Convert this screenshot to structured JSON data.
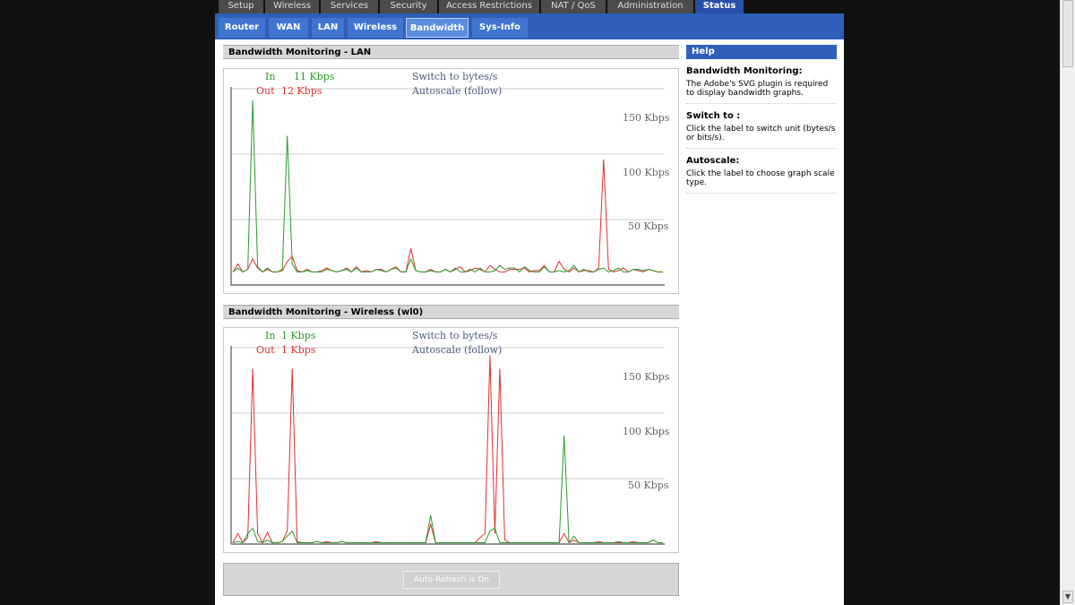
{
  "top_tabs": [
    {
      "label": "Setup",
      "active": false
    },
    {
      "label": "Wireless",
      "active": false
    },
    {
      "label": "Services",
      "active": false
    },
    {
      "label": "Security",
      "active": false
    },
    {
      "label": "Access Restrictions",
      "active": false
    },
    {
      "label": "NAT / QoS",
      "active": false
    },
    {
      "label": "Administration",
      "active": false
    },
    {
      "label": "Status",
      "active": true
    }
  ],
  "sub_tabs": [
    {
      "label": "Router",
      "active": false
    },
    {
      "label": "WAN",
      "active": false
    },
    {
      "label": "LAN",
      "active": false
    },
    {
      "label": "Wireless",
      "active": false
    },
    {
      "label": "Bandwidth",
      "active": true
    },
    {
      "label": "Sys-Info",
      "active": false
    }
  ],
  "colors": {
    "in": "#2a9a2a",
    "out": "#e03030",
    "accent": "#2f5fb8"
  },
  "lan": {
    "title": "Bandwidth Monitoring - LAN",
    "in_label": "In",
    "in_value": "11 Kbps",
    "out_label": "Out",
    "out_value": "12 Kbps",
    "switch_label": "Switch to bytes/s",
    "autoscale_label": "Autoscale (follow)",
    "y_ticks": [
      "150 Kbps",
      "100 Kbps",
      "50 Kbps"
    ],
    "chart_data": {
      "type": "line",
      "unit": "Kbps",
      "ylim": [
        0,
        165
      ],
      "y_ticks": [
        150,
        100,
        50
      ],
      "grid": true,
      "series": [
        {
          "name": "In",
          "color": "#2a9a2a",
          "values": [
            10,
            13,
            10,
            12,
            141,
            14,
            10,
            13,
            10,
            10,
            12,
            114,
            16,
            10,
            10,
            11,
            10,
            10,
            10,
            12,
            11,
            10,
            11,
            12,
            10,
            13,
            10,
            10,
            10,
            12,
            11,
            10,
            12,
            13,
            10,
            10,
            20,
            11,
            10,
            10,
            11,
            10,
            10,
            12,
            10,
            13,
            10,
            10,
            12,
            10,
            13,
            10,
            10,
            11,
            15,
            12,
            13,
            13,
            10,
            14,
            11,
            10,
            10,
            14,
            10,
            10,
            11,
            10,
            11,
            15,
            10,
            12,
            10,
            10,
            12,
            13,
            10,
            11,
            13,
            10,
            10,
            12,
            12,
            11,
            12,
            11,
            10,
            10
          ]
        },
        {
          "name": "Out",
          "color": "#e03030",
          "values": [
            10,
            16,
            10,
            12,
            20,
            13,
            10,
            12,
            10,
            10,
            11,
            18,
            22,
            11,
            10,
            12,
            10,
            10,
            11,
            13,
            11,
            10,
            11,
            13,
            10,
            14,
            10,
            11,
            10,
            12,
            12,
            10,
            12,
            14,
            10,
            10,
            28,
            11,
            10,
            10,
            12,
            10,
            10,
            12,
            10,
            12,
            14,
            10,
            11,
            13,
            12,
            10,
            15,
            12,
            10,
            10,
            12,
            12,
            12,
            13,
            10,
            11,
            11,
            15,
            10,
            10,
            18,
            12,
            10,
            13,
            10,
            11,
            11,
            10,
            13,
            96,
            12,
            10,
            11,
            13,
            10,
            12,
            11,
            10,
            12,
            11,
            10,
            10
          ]
        }
      ]
    }
  },
  "wireless": {
    "title": "Bandwidth Monitoring - Wireless (wl0)",
    "in_label": "In",
    "in_value": "1 Kbps",
    "out_label": "Out",
    "out_value": "1 Kbps",
    "switch_label": "Switch to bytes/s",
    "autoscale_label": "Autoscale (follow)",
    "y_ticks": [
      "150 Kbps",
      "100 Kbps",
      "50 Kbps"
    ],
    "chart_data": {
      "type": "line",
      "unit": "Kbps",
      "ylim": [
        0,
        165
      ],
      "y_ticks": [
        150,
        100,
        50
      ],
      "grid": true,
      "series": [
        {
          "name": "In",
          "color": "#2a9a2a",
          "values": [
            1,
            2,
            1,
            8,
            12,
            2,
            1,
            3,
            1,
            1,
            2,
            6,
            10,
            1,
            1,
            1,
            1,
            2,
            1,
            1,
            1,
            1,
            2,
            1,
            1,
            1,
            1,
            1,
            1,
            1,
            1,
            1,
            1,
            1,
            1,
            1,
            1,
            1,
            1,
            1,
            22,
            1,
            1,
            1,
            1,
            1,
            1,
            1,
            1,
            1,
            1,
            1,
            10,
            12,
            1,
            1,
            1,
            1,
            1,
            1,
            1,
            1,
            1,
            1,
            1,
            1,
            1,
            83,
            1,
            6,
            1,
            1,
            1,
            1,
            1,
            1,
            1,
            1,
            2,
            1,
            1,
            1,
            1,
            1,
            1,
            3,
            1,
            1
          ]
        },
        {
          "name": "Out",
          "color": "#e03030",
          "values": [
            1,
            8,
            1,
            5,
            134,
            8,
            1,
            9,
            1,
            1,
            2,
            10,
            134,
            2,
            1,
            1,
            1,
            2,
            1,
            2,
            1,
            1,
            2,
            1,
            1,
            1,
            1,
            1,
            1,
            2,
            1,
            1,
            1,
            1,
            1,
            1,
            1,
            1,
            1,
            1,
            15,
            1,
            1,
            1,
            1,
            1,
            1,
            1,
            1,
            1,
            5,
            8,
            144,
            8,
            134,
            3,
            1,
            1,
            1,
            1,
            1,
            1,
            1,
            1,
            1,
            1,
            1,
            8,
            1,
            3,
            1,
            1,
            1,
            1,
            2,
            1,
            1,
            1,
            1,
            1,
            1,
            2,
            1,
            1,
            1,
            3,
            1,
            1
          ]
        }
      ]
    }
  },
  "bottom": {
    "refresh_label": "Auto-Refresh is On"
  },
  "help": {
    "title": "Help",
    "items": [
      {
        "heading": "Bandwidth Monitoring:",
        "text": "The Adobe's SVG plugin is required to display bandwidth graphs."
      },
      {
        "heading": "Switch to :",
        "text": "Click the label to switch unit (bytes/s or bits/s)."
      },
      {
        "heading": "Autoscale:",
        "text": "Click the label to choose graph scale type."
      }
    ]
  }
}
